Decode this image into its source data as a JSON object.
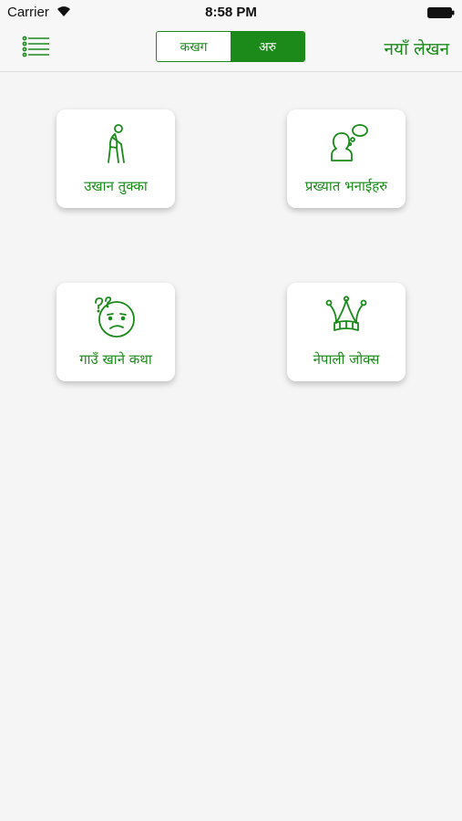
{
  "status_bar": {
    "carrier": "Carrier",
    "time": "8:58 PM"
  },
  "nav": {
    "menu_icon": "list-menu-icon",
    "segments": [
      {
        "label": "कखग",
        "selected": false
      },
      {
        "label": "अरु",
        "selected": true
      }
    ],
    "new_post_label": "नयाँ लेखन"
  },
  "tiles": [
    {
      "label": "उखान तुक्का",
      "icon": "old-man-with-cane-icon"
    },
    {
      "label": "प्रख्यात भनाईहरु",
      "icon": "person-speech-bubble-icon"
    },
    {
      "label": "गाउँ खाने कथा",
      "icon": "confused-face-icon"
    },
    {
      "label": "नेपाली जोक्स",
      "icon": "jester-hat-icon"
    }
  ],
  "colors": {
    "accent": "#1b8a1b",
    "background": "#f5f5f5"
  }
}
